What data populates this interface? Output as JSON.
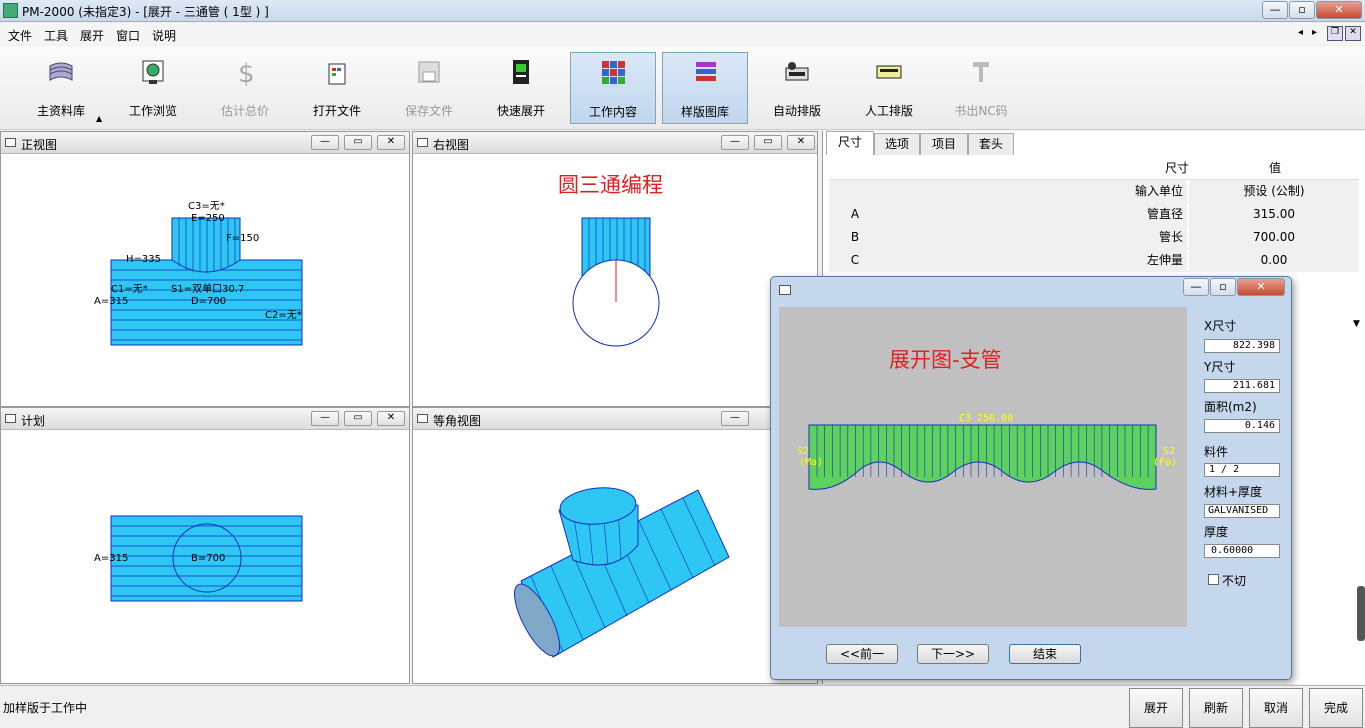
{
  "window": {
    "title": "PM-2000 (未指定3) - [展开 - 三通管 ( 1型 ) ]"
  },
  "menu": [
    "文件",
    "工具",
    "展开",
    "窗口",
    "说明"
  ],
  "toolbar": [
    {
      "label": "主资料库",
      "icon": "library-icon",
      "disabled": false
    },
    {
      "label": "工作浏览",
      "icon": "browse-icon",
      "disabled": false
    },
    {
      "label": "估计总价",
      "icon": "dollar-icon",
      "disabled": true
    },
    {
      "label": "打开文件",
      "icon": "open-file-icon",
      "disabled": false
    },
    {
      "label": "保存文件",
      "icon": "save-icon",
      "disabled": true
    },
    {
      "label": "快速展开",
      "icon": "quick-unfold-icon",
      "disabled": false
    },
    {
      "label": "工作内容",
      "icon": "grid-icon",
      "disabled": false,
      "active": true
    },
    {
      "label": "样版图库",
      "icon": "pattern-library-icon",
      "disabled": false,
      "active": true
    },
    {
      "label": "自动排版",
      "icon": "auto-nest-icon",
      "disabled": false
    },
    {
      "label": "人工排版",
      "icon": "manual-nest-icon",
      "disabled": false
    },
    {
      "label": "书出NC码",
      "icon": "nc-output-icon",
      "disabled": true
    }
  ],
  "panes": {
    "front": {
      "title": "正视图",
      "labels": {
        "c3": "C3=无*",
        "e": "E=250",
        "f": "F=150",
        "h": "H=335",
        "c1": "C1=无*",
        "s1": "S1=双单口30.7",
        "a": "A=315",
        "d": "D=700",
        "c2": "C2=无*"
      }
    },
    "right": {
      "title": "右视图",
      "caption": "圆三通编程"
    },
    "plan": {
      "title": "计划",
      "labels": {
        "a": "A=315",
        "b": "B=700"
      }
    },
    "iso": {
      "title": "等角视图"
    }
  },
  "props": {
    "tabs": [
      "尺寸",
      "选项",
      "项目",
      "套头"
    ],
    "header": {
      "name": "尺寸",
      "value": "值"
    },
    "rows": [
      {
        "key": "",
        "name": "输入单位",
        "value": "预设 (公制)"
      },
      {
        "key": "A",
        "name": "管直径",
        "value": "315.00"
      },
      {
        "key": "B",
        "name": "管长",
        "value": "700.00"
      },
      {
        "key": "C",
        "name": "左伸量",
        "value": "0.00"
      }
    ]
  },
  "dialog": {
    "caption": "展开图-支管",
    "top_label": "C3 250.00",
    "left_label": "S2\n(Ma)",
    "right_label": "S2\n(Fa)",
    "fields": [
      {
        "label": "X尺寸",
        "value": "822.398"
      },
      {
        "label": "Y尺寸",
        "value": "211.681"
      },
      {
        "label": "面积(m2)",
        "value": "0.146"
      },
      {
        "label": "料件",
        "value": "1 / 2"
      },
      {
        "label": "材料+厚度",
        "value": "GALVANISED"
      },
      {
        "label": "厚度",
        "value": "0.60000"
      }
    ],
    "checkbox": "不切",
    "buttons": {
      "prev": "<<前一",
      "next": "下一>>",
      "end": "结束"
    }
  },
  "status": {
    "text": "加样版于工作中"
  },
  "bottom_buttons": [
    "展开",
    "刷新",
    "取消",
    "完成"
  ]
}
